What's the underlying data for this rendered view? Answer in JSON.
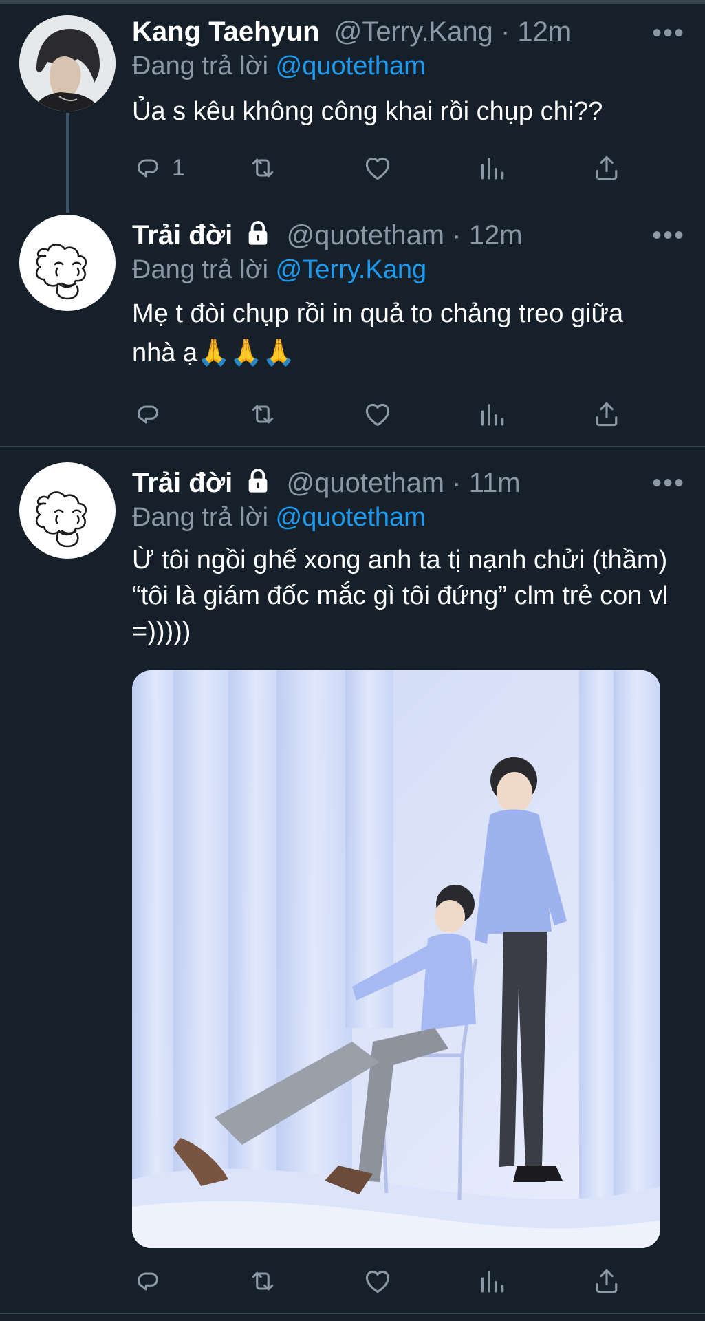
{
  "tweets": [
    {
      "name": "Kang Taehyun",
      "handle": "@Terry.Kang",
      "separator": "·",
      "time": "12m",
      "locked": false,
      "reply_prefix": "Đang trả lời",
      "reply_to": "@quotetham",
      "text": "Ủa s kêu không công khai rồi chụp chi??",
      "reply_count": "1"
    },
    {
      "name": "Trải đời",
      "handle": "@quotetham",
      "separator": "·",
      "time": "12m",
      "locked": true,
      "reply_prefix": "Đang trả lời",
      "reply_to": "@Terry.Kang",
      "text": "Mẹ t đòi chụp rồi in quả to chảng treo giữa nhà ạ🙏🙏🙏",
      "reply_count": ""
    },
    {
      "name": "Trải đời",
      "handle": "@quotetham",
      "separator": "·",
      "time": "11m",
      "locked": true,
      "reply_prefix": "Đang trả lời",
      "reply_to": "@quotetham",
      "text": "Ừ tôi ngồi ghế xong anh ta tị nạnh chửi (thầm) “tôi là giám đốc mắc gì tôi đứng” clm trẻ con vl =)))))",
      "reply_count": ""
    }
  ],
  "more_label": "•••",
  "icons": {
    "reply": "reply-icon",
    "retweet": "retweet-icon",
    "like": "heart-icon",
    "analytics": "analytics-icon",
    "share": "share-icon",
    "lock": "lock-icon",
    "more": "more-icon"
  },
  "colors": {
    "background": "#15202b",
    "text": "#ffffff",
    "muted": "#8b98a5",
    "link": "#1d9bf0",
    "divider": "#38444d"
  }
}
